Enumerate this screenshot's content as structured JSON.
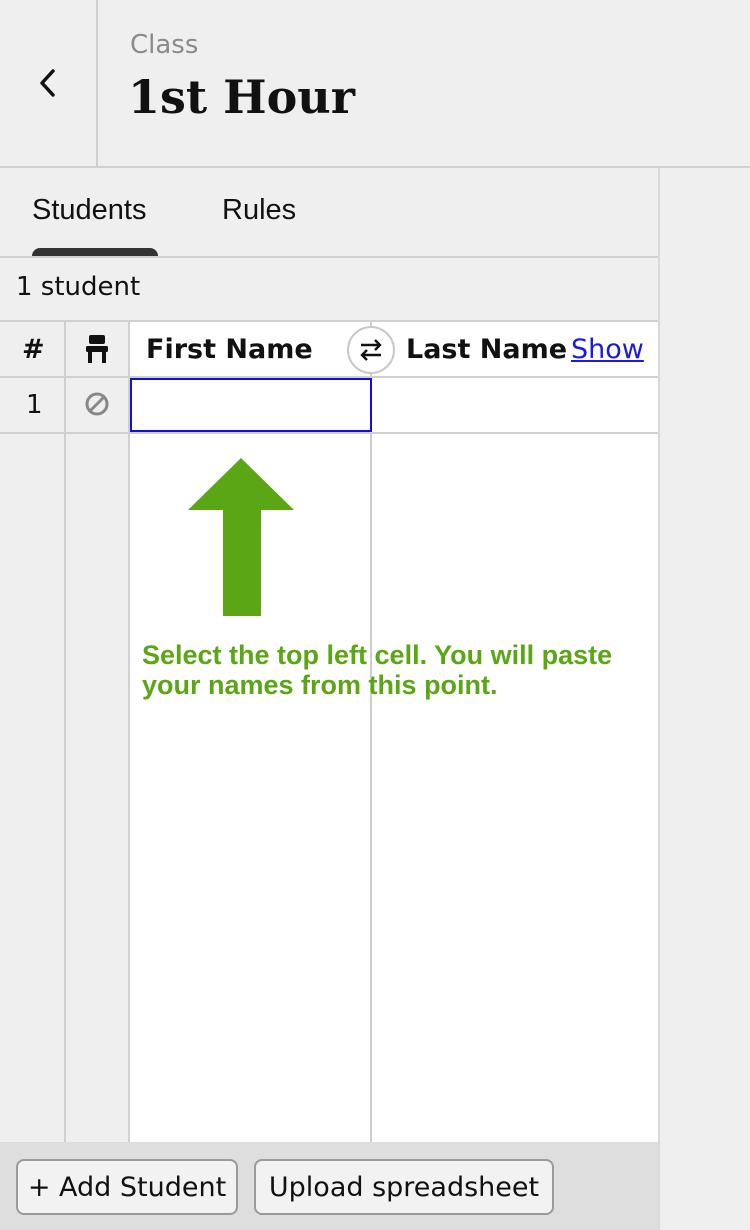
{
  "header": {
    "subtitle": "Class",
    "title": "1st Hour"
  },
  "tabs": [
    {
      "label": "Students",
      "active": true
    },
    {
      "label": "Rules",
      "active": false
    }
  ],
  "student_count": "1 student",
  "table": {
    "columns": {
      "number": "#",
      "first_name": "First Name",
      "last_name": "Last Name",
      "show_link": "Show"
    },
    "rows": [
      {
        "number": "1",
        "first_name": "",
        "last_name": ""
      }
    ]
  },
  "instruction": "Select the top left cell. You will paste your names from this point.",
  "footer": {
    "add_student": "+ Add Student",
    "upload": "Upload spreadsheet"
  },
  "colors": {
    "accent_green": "#5aa614",
    "selection_blue": "#1010d8",
    "link_blue": "#1a1ae0"
  },
  "icons": {
    "back": "chevron-left-icon",
    "seat": "chair-icon",
    "swap": "swap-arrows-icon",
    "disabled": "no-entry-icon",
    "arrow": "arrow-up-icon"
  }
}
